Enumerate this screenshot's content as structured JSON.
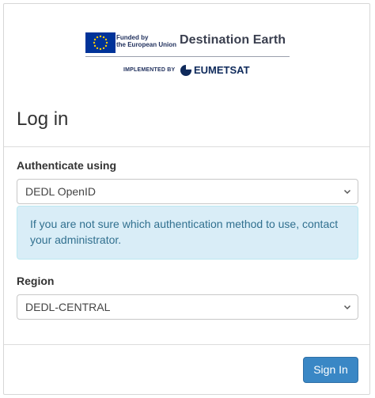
{
  "header": {
    "eu_funding_line1": "Funded by",
    "eu_funding_line2": "the European Union",
    "program_name": "Destination Earth",
    "implemented_by": "IMPLEMENTED BY",
    "implementer": "EUMETSAT"
  },
  "page": {
    "title": "Log in"
  },
  "auth": {
    "label": "Authenticate using",
    "selected": "DEDL OpenID",
    "info": "If you are not sure which authentication method to use, contact your administrator."
  },
  "region": {
    "label": "Region",
    "selected": "DEDL-CENTRAL"
  },
  "actions": {
    "sign_in": "Sign In"
  },
  "colors": {
    "primary_button": "#3a87c5",
    "info_background": "#d9edf7",
    "info_text": "#31708f",
    "eu_blue": "#003399",
    "eu_star": "#ffcc00"
  }
}
